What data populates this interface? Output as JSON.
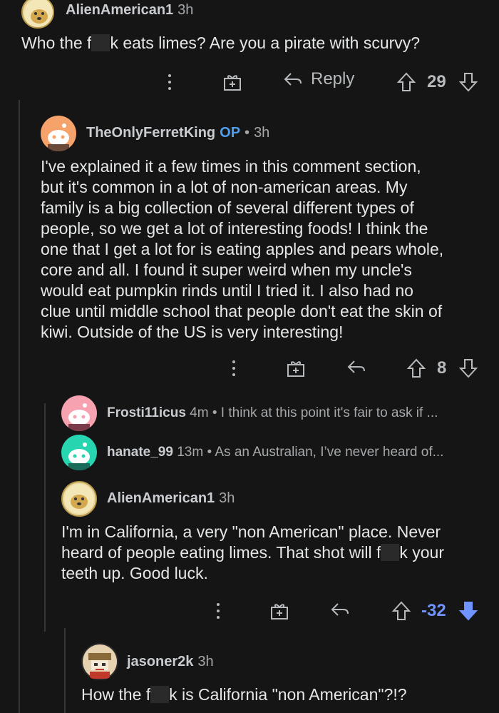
{
  "comments": [
    {
      "author": "AlienAmerican1",
      "time": "3h",
      "text_before": "Who the f",
      "text_after": "k eats limes?  Are you a pirate with scurvy?",
      "reply_label": "Reply",
      "score": "29"
    },
    {
      "author": "TheOnlyFerretKing",
      "op_badge": "OP",
      "dot": "•",
      "time": "3h",
      "lines": [
        "I've explained it a few times in this comment section,",
        "but it's common in a lot of non-american areas. My",
        "family is a big collection of several different types of",
        "people, so we get a lot of interesting foods! I think the",
        "one that I get a lot for is eating apples and pears whole,",
        "core and all. I found it super weird when my uncle's",
        "would eat pumpkin rinds until I tried it. I also had no",
        "clue until middle school that people don't eat the skin of",
        "kiwi. Outside of the US is very interesting!"
      ],
      "score": "8"
    },
    {
      "author": "Frosti11icus",
      "time": "4m",
      "dot": "•",
      "preview": "I think at this point it's fair to ask if ..."
    },
    {
      "author": "hanate_99",
      "time": "13m",
      "dot": "•",
      "preview": "As an Australian, I’ve never heard of..."
    },
    {
      "author": "AlienAmerican1",
      "time": "3h",
      "line1": "I'm in California, a very \"non American\" place.  Never",
      "line2_before": "heard of people eating limes.  That shot will f",
      "line2_after": "k your",
      "line3": "teeth up.  Good luck.",
      "score": "-32"
    },
    {
      "author": "jasoner2k",
      "time": "3h",
      "text_before": "How the f",
      "text_after": "k is California \"non American\"?!?"
    }
  ],
  "colors": {
    "background": "#151515",
    "op": "#4f9eed",
    "downvote": "#7193ff"
  }
}
